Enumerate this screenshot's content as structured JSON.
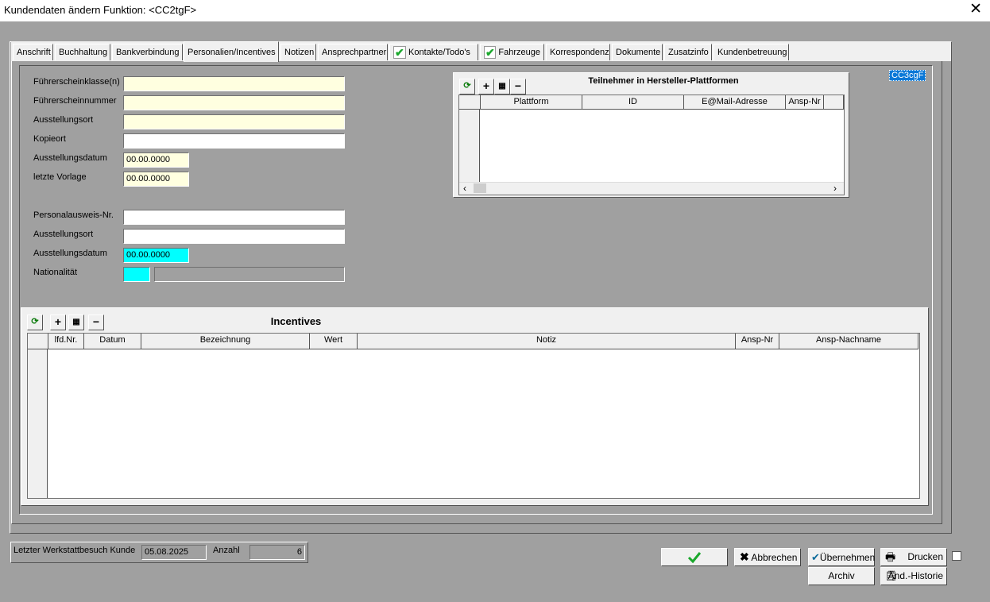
{
  "window": {
    "title": "Kundendaten ändern   Funktion: <CC2tgF>",
    "close_label": "✕"
  },
  "tabs": [
    {
      "label": "Anschrift",
      "checked": false
    },
    {
      "label": "Buchhaltung",
      "checked": false
    },
    {
      "label": "Bankverbindung",
      "checked": false
    },
    {
      "label": "Personalien/Incentives",
      "checked": false,
      "active": true
    },
    {
      "label": "Notizen",
      "checked": false
    },
    {
      "label": "Ansprechpartner",
      "checked": false
    },
    {
      "label": "Kontakte/Todo's",
      "checked": true
    },
    {
      "label": "Fahrzeuge",
      "checked": true
    },
    {
      "label": "Korrespondenz",
      "checked": false
    },
    {
      "label": "Dokumente",
      "checked": false
    },
    {
      "label": "Zusatzinfo",
      "checked": false
    },
    {
      "label": "Kundenbetreuung",
      "checked": false
    }
  ],
  "form": {
    "fuehrerscheinklasse_label": "Führerscheinklasse(n)",
    "fuehrerscheinklasse_value": "",
    "fuehrerscheinnummer_label": "Führerscheinnummer",
    "fuehrerscheinnummer_value": "",
    "ausstellungsort1_label": "Ausstellungsort",
    "ausstellungsort1_value": "",
    "kopieort_label": "Kopieort",
    "kopieort_value": "",
    "ausstellungsdatum1_label": "Ausstellungsdatum",
    "ausstellungsdatum1_value": "00.00.0000",
    "letzte_vorlage_label": "letzte Vorlage",
    "letzte_vorlage_value": "00.00.0000",
    "personalausweis_label": "Personalausweis-Nr.",
    "personalausweis_value": "",
    "ausstellungsort2_label": "Ausstellungsort",
    "ausstellungsort2_value": "",
    "ausstellungsdatum2_label": "Ausstellungsdatum",
    "ausstellungsdatum2_value": "00.00.0000",
    "nationalitaet_label": "Nationalität",
    "nationalitaet_code": "",
    "nationalitaet_name": ""
  },
  "code_label": "CC3cgF",
  "platforms": {
    "title": "Teilnehmer in Hersteller-Plattformen",
    "columns": [
      "Plattform",
      "ID",
      "E@Mail-Adresse",
      "Ansp-Nr"
    ]
  },
  "incentives": {
    "title": "Incentives",
    "columns": [
      "lfd.Nr.",
      "Datum",
      "Bezeichnung",
      "Wert",
      "Notiz",
      "Ansp-Nr",
      "Ansp-Nachname"
    ]
  },
  "footer": {
    "letzter_werkstattbesuch_label": "Letzter Werkstattbesuch Kunde",
    "letzter_werkstattbesuch_value": "05.08.2025",
    "anzahl_label": "Anzahl",
    "anzahl_value": "6"
  },
  "buttons": {
    "ok_label": "OK",
    "abbrechen_label": "Abbrechen",
    "uebernehmen_label": "Übernehmen",
    "drucken_label": "Drucken",
    "archiv_label": "Archiv",
    "aend_historie_label": "Änd.-Historie"
  }
}
